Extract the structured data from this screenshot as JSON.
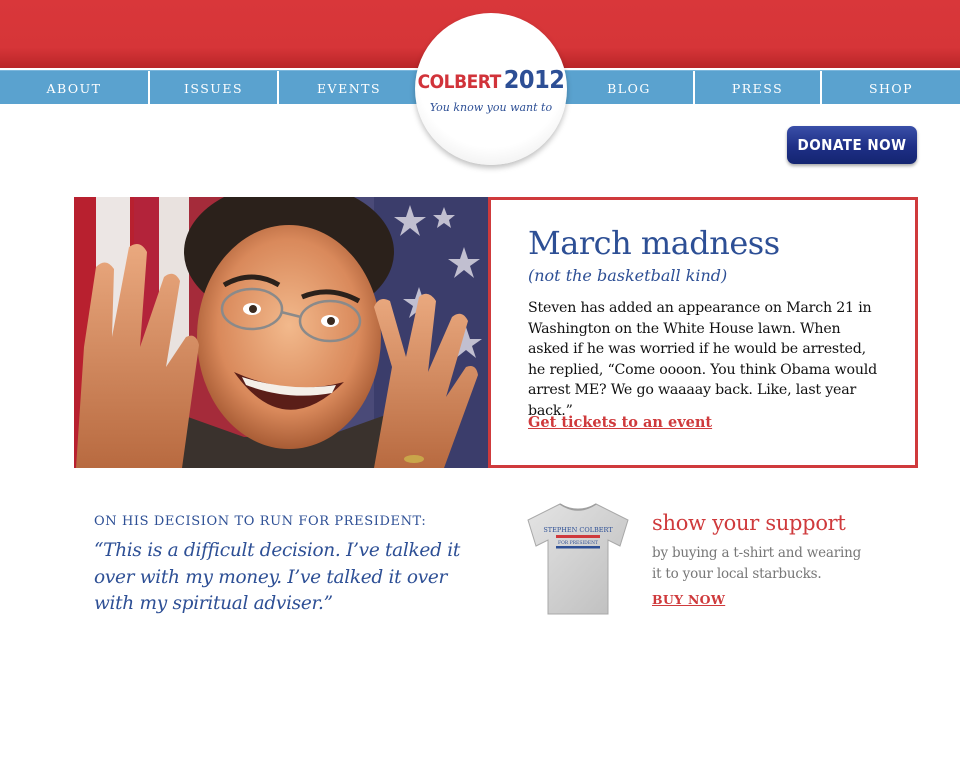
{
  "nav": {
    "items": [
      {
        "label": "ABOUT"
      },
      {
        "label": "ISSUES"
      },
      {
        "label": "EVENTS"
      },
      {
        "label": "BLOG"
      },
      {
        "label": "PRESS"
      },
      {
        "label": "SHOP"
      }
    ]
  },
  "logo": {
    "name": "COLBERT",
    "year": "2012",
    "tagline": "You know you want to"
  },
  "donate": {
    "label": "DONATE NOW"
  },
  "hero": {
    "title": "March madness",
    "subtitle": "(not the basketball kind)",
    "body": "Steven has added an appearance on March 21 in Washington on the White House lawn. When asked if he was worried if he would be arrested, he replied, “Come oooon. You think Obama would arrest ME? We go waaaay back. Like, last year back.”",
    "link": "Get tickets to an event"
  },
  "quote": {
    "label": "ON HIS DECISION TO RUN FOR PRESIDENT:",
    "text": "“This is a difficult decision. I’ve talked it over  with my money. I’ve talked it over with my spiritual adviser.”"
  },
  "support": {
    "title": "show your support",
    "text": "by buying a t-shirt and wearing it to your local starbucks.",
    "link": "BUY NOW",
    "shirt_print_line1": "STEPHEN COLBERT",
    "shirt_print_line2": "FOR PRESIDENT"
  },
  "colors": {
    "brand_red": "#d9373a",
    "nav_blue": "#5aa2cf",
    "text_blue": "#2d4f95",
    "donate_blue": "#1e2f86",
    "link_red": "#cf3a3c"
  }
}
